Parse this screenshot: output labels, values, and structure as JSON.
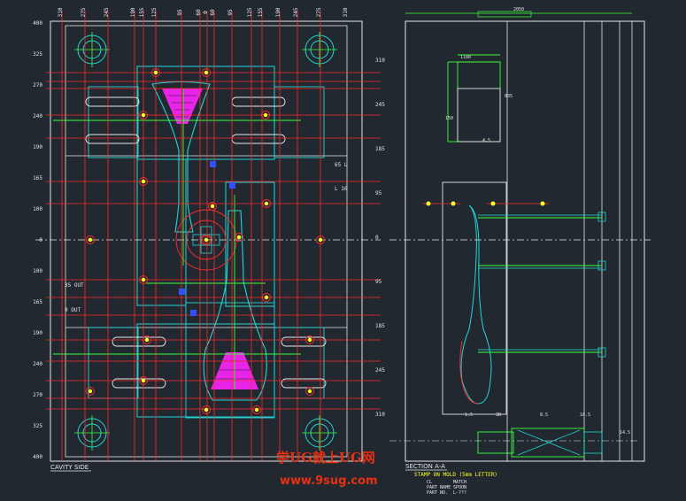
{
  "drawing": {
    "left_view_title": "CAVITY SIDE",
    "right_view_title": "SECTION A-A",
    "note_title": "STAMP ON MOLD (5mm LETTER)",
    "notes": [
      "CL",
      "PART NAME",
      "PART NO."
    ],
    "note_values": [
      "MATCH",
      "SPOON",
      "L-???"
    ],
    "callouts": [
      {
        "text": "35 OUT"
      },
      {
        "text": "0 OUT"
      },
      {
        "text": "65 L"
      },
      {
        "text": "L 16"
      }
    ],
    "left_dims": [
      "400",
      "325",
      "270",
      "240",
      "190",
      "165",
      "100",
      "0",
      "100",
      "165",
      "190",
      "240",
      "270",
      "325",
      "400"
    ],
    "right_dims": [
      "310",
      "245",
      "185",
      "95",
      "0",
      "95",
      "185",
      "245",
      "310"
    ],
    "top_dims": [
      "310",
      "275",
      "245",
      "190",
      "155",
      "125",
      "95",
      "60",
      "0",
      "60",
      "95",
      "125",
      "155",
      "190",
      "245",
      "275",
      "310"
    ],
    "section_dims": [
      "2050",
      "1180",
      "835",
      "150",
      "4.5",
      "1.5",
      "38",
      "8.5",
      "10.5",
      "14.5"
    ]
  },
  "watermark": {
    "line1": "学UG就上UG网",
    "line2": "www.9sug.com"
  },
  "colors": {
    "background": "#212830",
    "outline": "#e6e6e6",
    "cyan": "#22d8d8",
    "red": "#ff2a2a",
    "yellow": "#ffff20",
    "green": "#3cff3c",
    "magenta": "#ff22ff",
    "blue": "#3050ff",
    "watermark": "#e83010"
  }
}
